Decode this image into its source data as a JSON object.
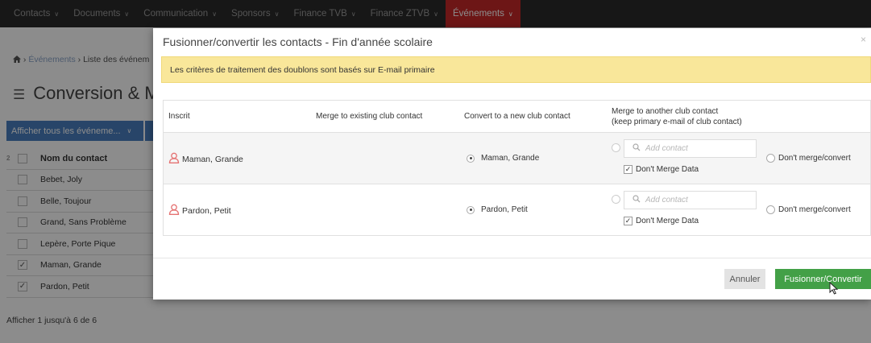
{
  "topnav": {
    "items": [
      {
        "label": "Contacts"
      },
      {
        "label": "Documents"
      },
      {
        "label": "Communication"
      },
      {
        "label": "Sponsors"
      },
      {
        "label": "Finance TVB"
      },
      {
        "label": "Finance ZTVB"
      },
      {
        "label": "Événements"
      }
    ],
    "active_index": 6
  },
  "breadcrumb": {
    "home_icon": "home-icon",
    "sep1": "›",
    "item1": "Événements",
    "sep2": "›",
    "item2": "Liste des événem"
  },
  "page": {
    "title": "Conversion & M",
    "filter_button": "Afficher tous les événeme...",
    "caret": "∨"
  },
  "bg_table": {
    "header_num": "2",
    "header": "Nom du contact",
    "rows": [
      {
        "name": "Bebet, Joly",
        "checked": false
      },
      {
        "name": "Belle, Toujour",
        "checked": false
      },
      {
        "name": "Grand, Sans Problème",
        "checked": false
      },
      {
        "name": "Lepère, Porte Pique",
        "checked": false
      },
      {
        "name": "Maman, Grande",
        "checked": true
      },
      {
        "name": "Pardon, Petit",
        "checked": true
      }
    ],
    "footer": "Afficher 1 jusqu'à 6 de 6"
  },
  "modal": {
    "title": "Fusionner/convertir les contacts - Fin d'année scolaire",
    "close": "×",
    "alert": "Les critères de traitement des doublons sont basés sur E-mail primaire",
    "columns": {
      "inscrit": "Inscrit",
      "existing": "Merge to existing club contact",
      "new": "Convert to a new club contact",
      "merge_line1": "Merge to another club contact",
      "merge_line2": "(keep primary e-mail of club contact)"
    },
    "rows": [
      {
        "name": "Maman, Grande",
        "new_contact": "Maman, Grande",
        "new_selected": true,
        "add_placeholder": "Add contact",
        "dont_merge_data": "Don't Merge Data",
        "dont_merge_checked": true,
        "dont_merge_convert": "Don't merge/convert"
      },
      {
        "name": "Pardon, Petit",
        "new_contact": "Pardon, Petit",
        "new_selected": true,
        "add_placeholder": "Add contact",
        "dont_merge_data": "Don't Merge Data",
        "dont_merge_checked": true,
        "dont_merge_convert": "Don't merge/convert"
      }
    ],
    "cancel_label": "Annuler",
    "submit_label": "Fusionner/Convertir",
    "colors": {
      "alert_bg": "#f9e79a",
      "submit_bg": "#43a047",
      "user_icon": "#e57373",
      "active_nav": "#c62828"
    }
  }
}
